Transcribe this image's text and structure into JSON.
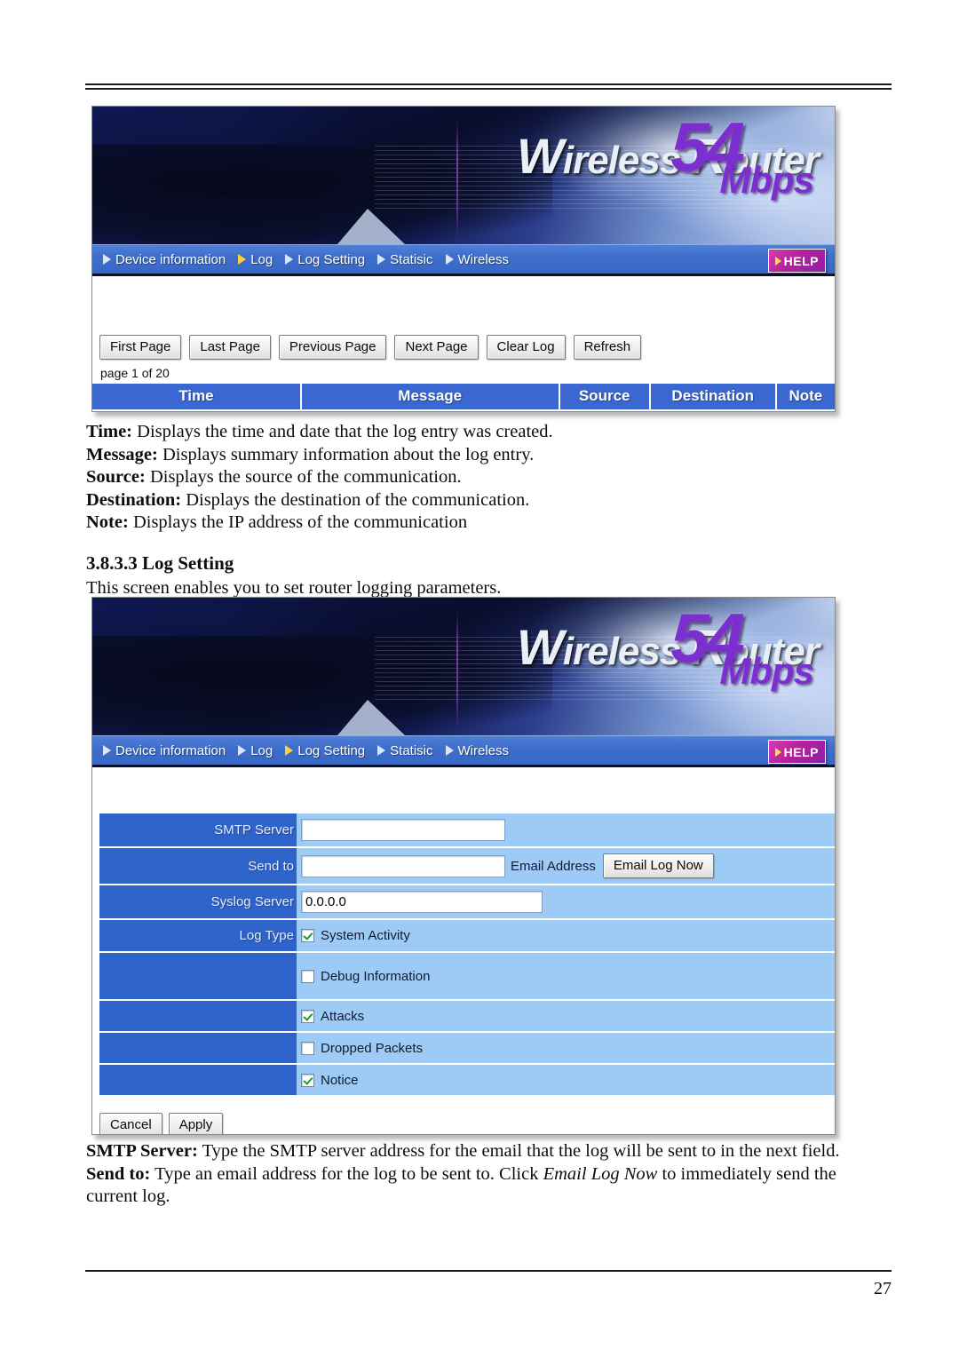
{
  "document": {
    "page_number": "27"
  },
  "log_screenshot": {
    "banner": {
      "brand_prefix": "W",
      "brand_word1": "ireless ",
      "brand_cap2": "R",
      "brand_word2": "outer",
      "speed": "54",
      "unit": "Mbps"
    },
    "nav": {
      "items": [
        {
          "label": "Device information",
          "active": false
        },
        {
          "label": "Log",
          "active": true
        },
        {
          "label": "Log Setting",
          "active": false
        },
        {
          "label": "Statisic",
          "active": false
        },
        {
          "label": "Wireless",
          "active": false
        }
      ],
      "help_label": "HELP"
    },
    "pager_buttons": [
      "First Page",
      "Last Page",
      "Previous Page",
      "Next Page",
      "Clear Log",
      "Refresh"
    ],
    "page_status": "page 1 of 20",
    "table_headers": [
      "Time",
      "Message",
      "Source",
      "Destination",
      "Note"
    ]
  },
  "column_descriptions": [
    {
      "term": "Time:",
      "text": " Displays the time and date that the log entry was created."
    },
    {
      "term": "Message:",
      "text": " Displays summary information about the log entry."
    },
    {
      "term": "Source:",
      "text": " Displays the source of the communication."
    },
    {
      "term": "Destination:",
      "text": " Displays the destination of the communication."
    },
    {
      "term": "Note:",
      "text": " Displays the IP address of the communication"
    }
  ],
  "section": {
    "heading": "3.8.3.3 Log Setting",
    "intro": "This screen enables you to set router logging parameters."
  },
  "logsetting_screenshot": {
    "banner": {
      "brand_prefix": "W",
      "brand_word1": "ireless ",
      "brand_cap2": "R",
      "brand_word2": "outer",
      "speed": "54",
      "unit": "Mbps"
    },
    "nav": {
      "items": [
        {
          "label": "Device information",
          "active": false
        },
        {
          "label": "Log",
          "active": false
        },
        {
          "label": "Log Setting",
          "active": true
        },
        {
          "label": "Statisic",
          "active": false
        },
        {
          "label": "Wireless",
          "active": false
        }
      ],
      "help_label": "HELP"
    },
    "form": {
      "smtp_server": {
        "label": "SMTP Server",
        "value": "",
        "placeholder": ""
      },
      "send_to": {
        "label": "Send to",
        "value": "",
        "placeholder": "",
        "suffix_label": "Email Address",
        "button_label": "Email Log Now"
      },
      "syslog_server": {
        "label": "Syslog Server",
        "value": "0.0.0.0",
        "placeholder": ""
      },
      "log_type": {
        "label": "Log Type",
        "options": [
          {
            "label": "System Activity",
            "checked": true
          },
          {
            "label": "Debug Information",
            "checked": false
          },
          {
            "label": "Attacks",
            "checked": true
          },
          {
            "label": "Dropped Packets",
            "checked": false
          },
          {
            "label": "Notice",
            "checked": true
          }
        ]
      },
      "cancel_label": "Cancel",
      "apply_label": "Apply"
    }
  },
  "field_descriptions": {
    "smtp_term": "SMTP Server:",
    "smtp_text": " Type the SMTP server address for the email that the log will be sent to in the next field.",
    "sendto_term": "Send to:",
    "sendto_text_1": " Type an email address for the log to be sent to. Click ",
    "sendto_italic": "Email Log Now",
    "sendto_text_2": " to immediately send the current log."
  },
  "colors": {
    "nav_blue": "#3f6fcd",
    "table_header_blue": "#3a67d0",
    "form_label_blue": "#2f63cc",
    "form_value_blue": "#9ecbf5",
    "brand_purple": "#7b2fcf",
    "help_magenta": "#b5229a",
    "check_green": "#1d9a2e"
  }
}
